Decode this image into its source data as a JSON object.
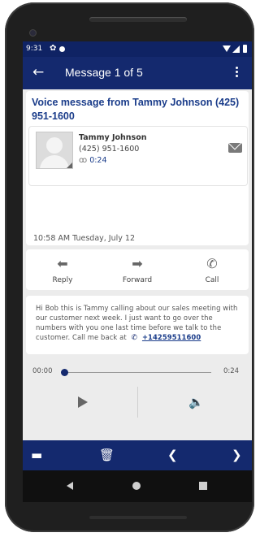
{
  "status_bar": {
    "time": "9:31"
  },
  "app_bar": {
    "title": "Message 1 of 5",
    "back_icon": "arrow-left-icon",
    "menu_icon": "more-vert-icon"
  },
  "header": {
    "title": "Voice message from Tammy Johnson (425) 951-1600",
    "contact": {
      "name": "Tammy Johnson",
      "phone": "(425) 951-1600",
      "duration": "0:24"
    },
    "date_time": "10:58 AM  Tuesday, July 12"
  },
  "actions": [
    {
      "label": "Reply",
      "icon": "reply-icon"
    },
    {
      "label": "Forward",
      "icon": "forward-icon"
    },
    {
      "label": "Call",
      "icon": "phone-icon"
    }
  ],
  "message": {
    "text": "Hi Bob this is Tammy calling about our sales meeting with our customer next week. I just want to go over the numbers with you one last time before we talk to the customer. Call me back at",
    "phone_link": "+14259511600"
  },
  "player": {
    "current_time": "00:00",
    "total_time": "0:24",
    "progress": 0
  },
  "bottom_bar": [
    "folder-icon",
    "trash-icon",
    "chevron-left-icon",
    "chevron-right-icon"
  ],
  "colors": {
    "primary": "#14296e",
    "status_bar": "#0f2364",
    "accent_text": "#1a3c8a",
    "background": "#ececec"
  }
}
